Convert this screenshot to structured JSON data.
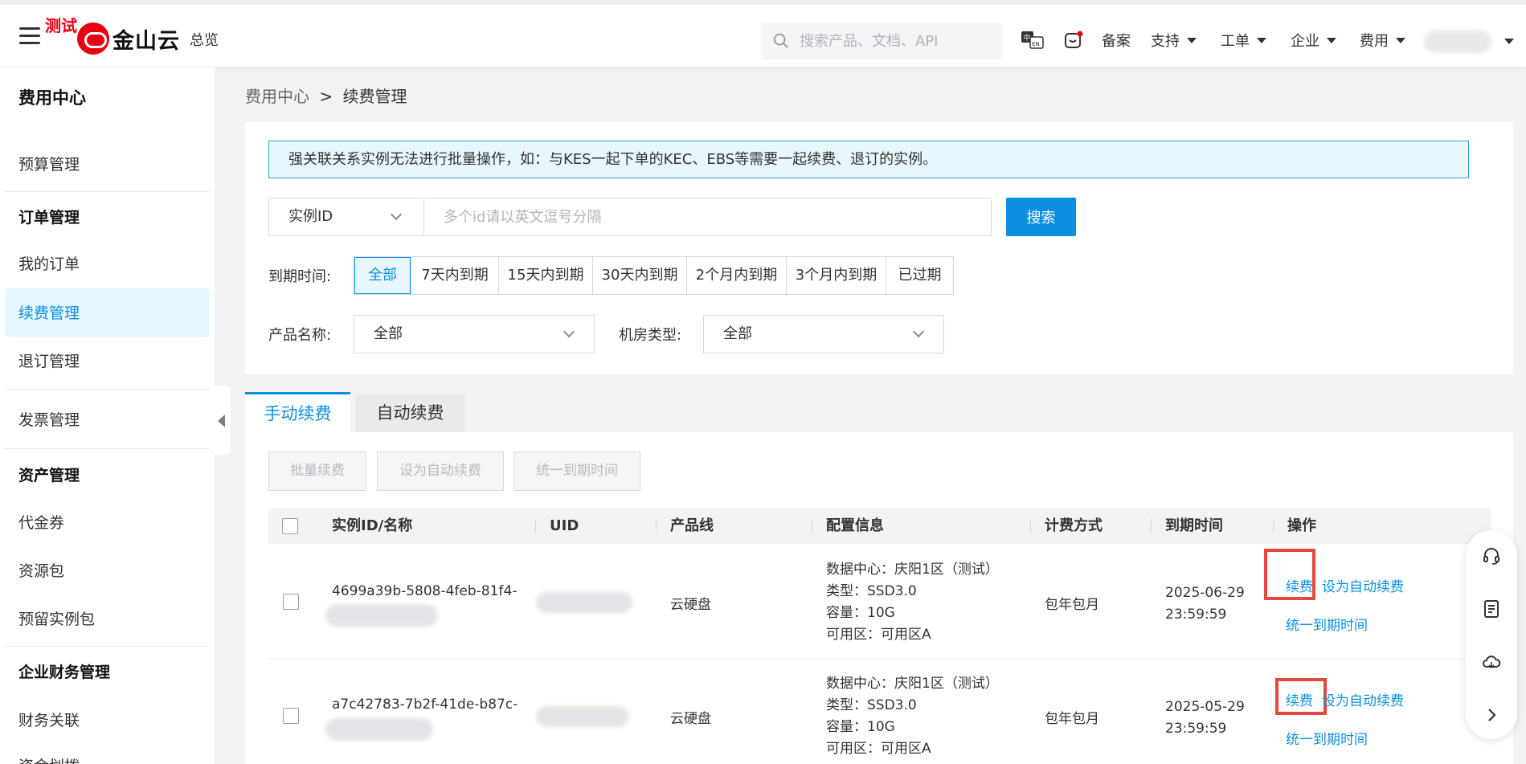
{
  "header": {
    "test_badge": "测试",
    "logo_text": "金山云",
    "overview": "总览",
    "search_placeholder": "搜索产品、文档、API",
    "nav": {
      "beian": "备案",
      "support": "支持",
      "ticket": "工单",
      "enterprise": "企业",
      "billing": "费用"
    }
  },
  "sidebar": {
    "title": "费用中心",
    "budget": "预算管理",
    "order_group": "订单管理",
    "my_orders": "我的订单",
    "renewal": "续费管理",
    "refund": "退订管理",
    "invoice": "发票管理",
    "asset_group": "资产管理",
    "voucher": "代金券",
    "package": "资源包",
    "reserved": "预留实例包",
    "finance_group": "企业财务管理",
    "finance_link": "财务关联",
    "fund_transfer": "资金划拨"
  },
  "breadcrumb": {
    "parent": "费用中心",
    "sep": ">",
    "current": "续费管理"
  },
  "filters": {
    "notice": "强关联关系实例无法进行批量操作，如：与KES一起下单的KEC、EBS等需要一起续费、退订的实例。",
    "field_select": "实例ID",
    "id_placeholder": "多个id请以英文逗号分隔",
    "search_button": "搜索",
    "expire_label": "到期时间:",
    "expire_options": [
      "全部",
      "7天内到期",
      "15天内到期",
      "30天内到期",
      "2个月内到期",
      "3个月内到期",
      "已过期"
    ],
    "product_label": "产品名称:",
    "product_value": "全部",
    "room_label": "机房类型:",
    "room_value": "全部"
  },
  "tabs": {
    "manual": "手动续费",
    "auto": "自动续费"
  },
  "actions": {
    "batch_renew": "批量续费",
    "set_auto": "设为自动续费",
    "unify_expire": "统一到期时间"
  },
  "table": {
    "headers": [
      "实例ID/名称",
      "UID",
      "产品线",
      "配置信息",
      "计费方式",
      "到期时间",
      "操作"
    ],
    "rows": [
      {
        "instance_id": "4699a39b-5808-4feb-81f4-",
        "product": "云硬盘",
        "cfg_dc": "数据中心：庆阳1区（测试）",
        "cfg_type": "类型：SSD3.0",
        "cfg_cap": "容量：10G",
        "cfg_zone": "可用区：可用区A",
        "billing": "包年包月",
        "expire_date": "2025-06-29",
        "expire_time": "23:59:59",
        "op_renew": "续费",
        "op_auto": "设为自动续费",
        "op_unify": "统一到期时间"
      },
      {
        "instance_id": "a7c42783-7b2f-41de-b87c-",
        "product": "云硬盘",
        "cfg_dc": "数据中心：庆阳1区（测试）",
        "cfg_type": "类型：SSD3.0",
        "cfg_cap": "容量：10G",
        "cfg_zone": "可用区：可用区A",
        "billing": "包年包月",
        "expire_date": "2025-05-29",
        "expire_time": "23:59:59",
        "op_renew": "续费",
        "op_auto": "设为自动续费",
        "op_unify": "统一到期时间"
      }
    ]
  },
  "colors": {
    "accent": "#0c8fe0",
    "brand_red": "#e60012",
    "highlight_box": "#e8473c",
    "notice_bg": "#e8f7fd"
  },
  "icons": [
    "menu-icon",
    "search-icon",
    "language-icon",
    "message-icon",
    "headset-icon",
    "document-icon",
    "cloud-icon",
    "chevron-right-icon"
  ]
}
